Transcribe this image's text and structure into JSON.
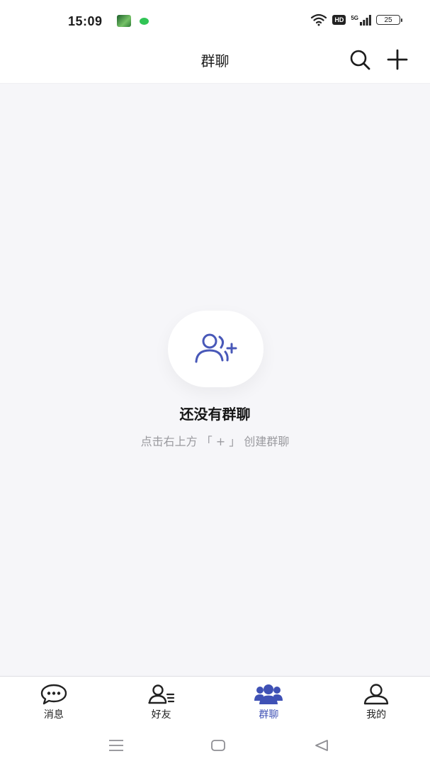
{
  "status_bar": {
    "time": "15:09",
    "network_badge": "HD",
    "network_type": "5G",
    "battery_level": "25",
    "icons": [
      "app-notification-icon",
      "wechat-notification-icon",
      "wifi-icon",
      "signal-icon",
      "battery-icon"
    ]
  },
  "header": {
    "title": "群聊",
    "actions": [
      "search-icon",
      "plus-icon"
    ]
  },
  "empty_state": {
    "icon": "add-group-icon",
    "title": "还没有群聊",
    "hint": "点击右上方 「 + 」 创建群聊"
  },
  "tabs": [
    {
      "label": "消息",
      "icon": "chat-bubble-icon",
      "active": false
    },
    {
      "label": "好友",
      "icon": "friends-list-icon",
      "active": false
    },
    {
      "label": "群聊",
      "icon": "group-icon",
      "active": true
    },
    {
      "label": "我的",
      "icon": "profile-icon",
      "active": false
    }
  ],
  "colors": {
    "accent": "#3f51b5",
    "background": "#f6f6f9",
    "hint_text": "#9a9a9f"
  },
  "nav_bar": [
    "menu-icon",
    "home-icon",
    "back-icon"
  ]
}
